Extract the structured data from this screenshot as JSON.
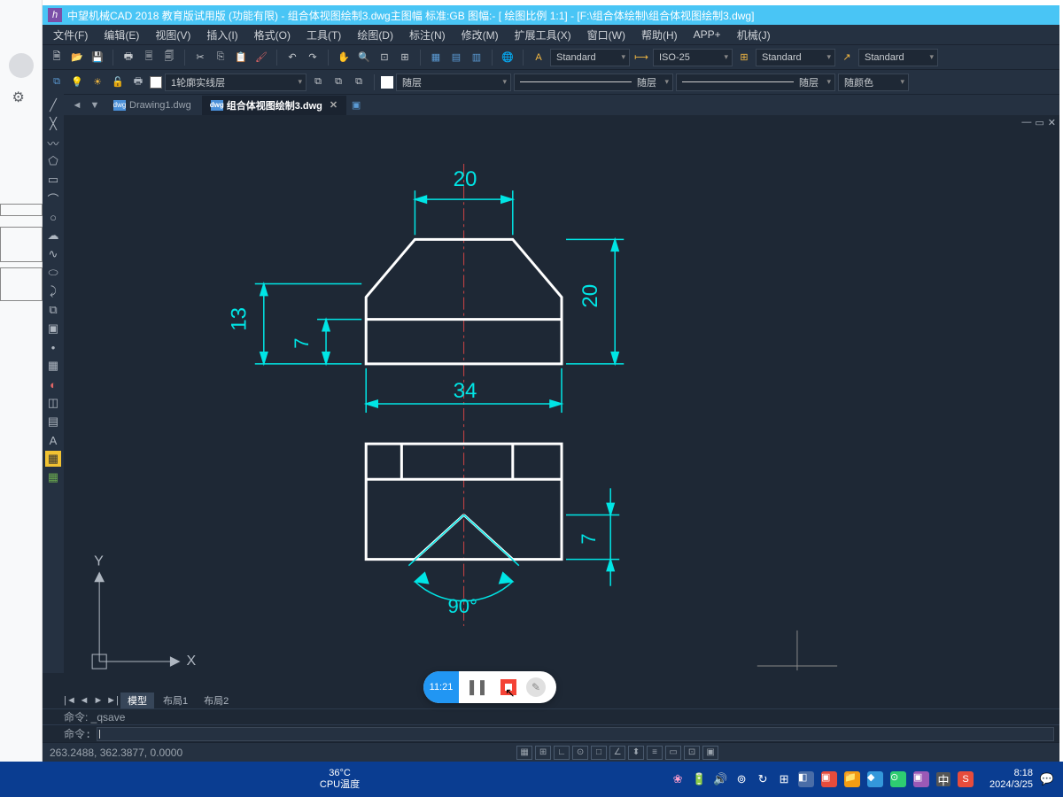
{
  "title": "中望机械CAD 2018 教育版试用版   (功能有限)   - 组合体视图绘制3.dwg主图幅   标准:GB 图幅:- [ 绘图比例 1:1] - [F:\\组合体绘制\\组合体视图绘制3.dwg]",
  "menu": [
    "文件(F)",
    "编辑(E)",
    "视图(V)",
    "插入(I)",
    "格式(O)",
    "工具(T)",
    "绘图(D)",
    "标注(N)",
    "修改(M)",
    "扩展工具(X)",
    "窗口(W)",
    "帮助(H)",
    "APP+",
    "机械(J)"
  ],
  "toolbar1": {
    "style1": "Standard",
    "style2": "ISO-25",
    "style3": "Standard",
    "style4": "Standard"
  },
  "toolbar2": {
    "layer": "1轮廓实线层",
    "ddl1": "随层",
    "ddl2": "随层",
    "ddl3": "随层",
    "ddl4": "随颜色"
  },
  "tabs": {
    "t1": "Drawing1.dwg",
    "t2": "组合体视图绘制3.dwg"
  },
  "layout": {
    "model": "模型",
    "l1": "布局1",
    "l2": "布局2"
  },
  "cmd": {
    "prev": "命令:  _qsave",
    "prompt": "命令:"
  },
  "status": {
    "coords": "263.2488, 362.3877, 0.0000"
  },
  "dims": {
    "d20a": "20",
    "d20b": "20",
    "d13": "13",
    "d7a": "7",
    "d34": "34",
    "d7b": "7",
    "ang": "90°"
  },
  "axes": {
    "x": "X",
    "y": "Y"
  },
  "recorder": {
    "time": "11:21"
  },
  "taskbar": {
    "temp": "36°C",
    "temp2": "CPU温度",
    "lang": "中",
    "time": "8:18",
    "date": "2024/3/25"
  }
}
